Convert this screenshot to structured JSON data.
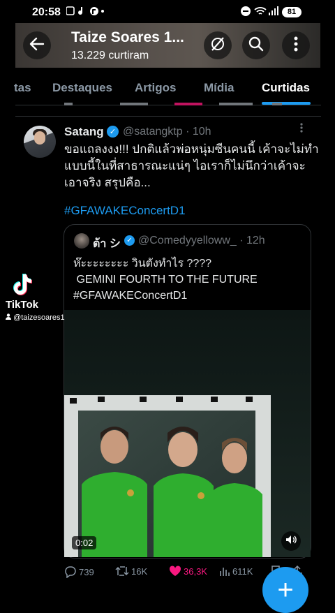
{
  "status_bar": {
    "time": "20:58",
    "battery": "81"
  },
  "header": {
    "title": "Taize Soares 1...",
    "subtitle": "13.229 curtiram"
  },
  "tabs": [
    {
      "label": "tas"
    },
    {
      "label": "Destaques"
    },
    {
      "label": "Artigos"
    },
    {
      "label": "Mídia"
    },
    {
      "label": "Curtidas",
      "active": true
    }
  ],
  "tweet": {
    "name": "Satang",
    "handle": "@satangktp",
    "time": "· 10h",
    "text": "ขอแถลงงง!!! ปกติแล้วพ่อหนุ่มซีนคนนี้ เค้าจะไม่ทำแบบนี้ในที่สาธารณะแน่ๆ ไอเราก็ไม่นึกว่าเค้าจะเอาจริง สรุปคือ...",
    "hashtag": "#GFAWAKEConcertD1",
    "quote": {
      "name": "ต้า シ",
      "handle": "@Comedyyelloww_",
      "time": "· 12h",
      "line1": "ห๊ะะะะะะะะ วินตังทำไร ????",
      "line2": " GEMINI FOURTH TO THE FUTURE",
      "line3": "#GFAWAKEConcertD1",
      "video_duration": "0:02"
    },
    "actions": {
      "replies": "739",
      "retweets": "16K",
      "likes": "36,3K",
      "views": "611K"
    }
  },
  "fab": {
    "label": "+"
  },
  "tiktok": {
    "brand": "TikTok",
    "user": "@taizesoares1"
  },
  "colors": {
    "accent": "#1d9bf0",
    "like": "#f91880",
    "muted": "#71767b"
  }
}
